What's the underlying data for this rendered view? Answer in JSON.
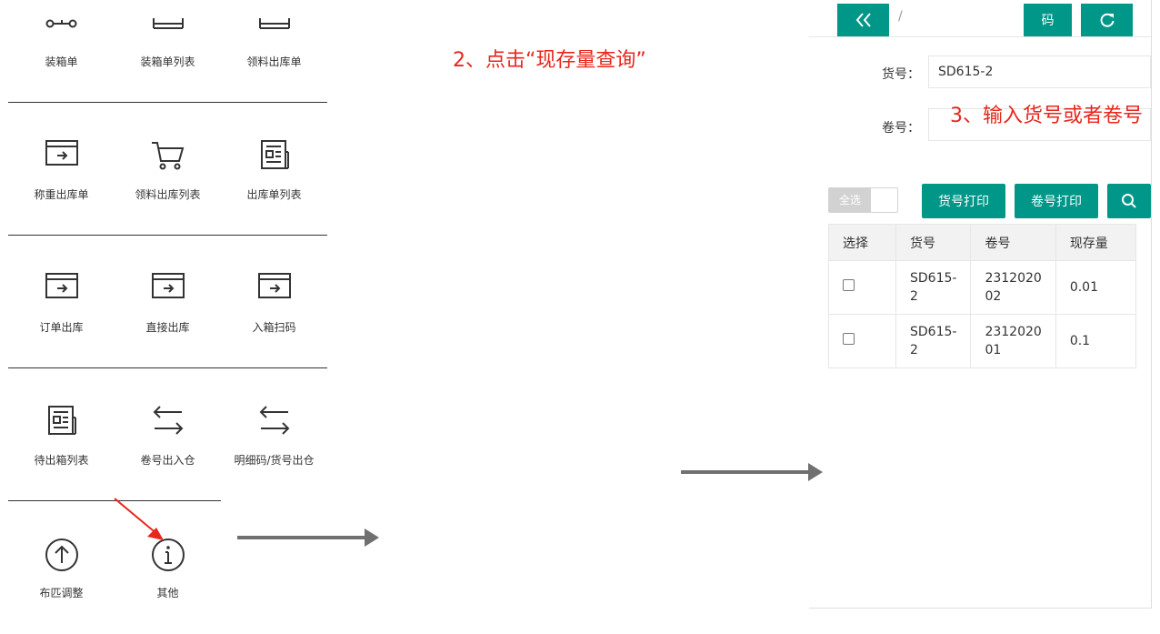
{
  "menu": {
    "rows": [
      [
        {
          "label": "装箱单",
          "icon": "key-link-icon"
        },
        {
          "label": "装箱单列表",
          "icon": "window-icon"
        },
        {
          "label": "领料出库单",
          "icon": "window-icon"
        }
      ],
      [
        {
          "label": "称重出库单",
          "icon": "exit-window-icon"
        },
        {
          "label": "领料出库列表",
          "icon": "cart-icon"
        },
        {
          "label": "出库单列表",
          "icon": "newspaper-icon"
        }
      ],
      [
        {
          "label": "订单出库",
          "icon": "exit-window-icon"
        },
        {
          "label": "直接出库",
          "icon": "exit-window-icon"
        },
        {
          "label": "入箱扫码",
          "icon": "exit-window-icon"
        }
      ],
      [
        {
          "label": "待出箱列表",
          "icon": "newspaper-icon"
        },
        {
          "label": "卷号出入仓",
          "icon": "transfer-icon"
        },
        {
          "label": "明细码/货号出仓",
          "icon": "transfer-icon"
        }
      ],
      [
        {
          "label": "布匹调整",
          "icon": "arrow-up-circle-icon"
        },
        {
          "label": "其他",
          "icon": "info-circle-icon"
        }
      ]
    ]
  },
  "annotations": {
    "step2": "2、点击“现存量查询”",
    "step3": "3、输入货号或者卷号"
  },
  "panel": {
    "topbar": {
      "back_icon": "double-chevron-left-icon",
      "breadcrumb_sep": "/",
      "code_button": "码",
      "refresh_icon": "refresh-icon"
    },
    "form": {
      "item_no_label": "货号：",
      "item_no_value": "SD615-2",
      "roll_no_label": "卷号：",
      "roll_no_value": ""
    },
    "toolbar": {
      "select_all": "全选",
      "print_item": "货号打印",
      "print_roll": "卷号打印",
      "search_icon": "search-icon"
    },
    "table": {
      "headers": [
        "选择",
        "货号",
        "卷号",
        "现存量"
      ],
      "rows": [
        {
          "item": "SD615-\n2",
          "roll": "2312020\n02",
          "stock": "0.01",
          "checked": false
        },
        {
          "item": "SD615-\n2",
          "roll": "2312020\n01",
          "stock": "0.1",
          "checked": false
        }
      ]
    }
  },
  "colors": {
    "accent": "#009688",
    "annotation": "#e8261c",
    "arrow": "#707070"
  }
}
